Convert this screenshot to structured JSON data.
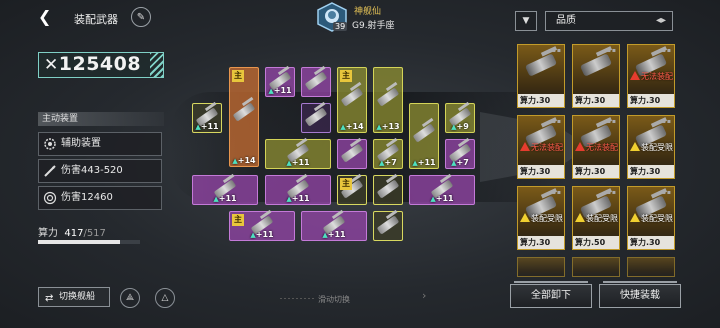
{
  "header": {
    "title": "装配武器",
    "commander_name": "神舰仙",
    "commander_sub": "G9.射手座",
    "commander_level": "39"
  },
  "left_panel": {
    "power_value": "125408",
    "active_label": "主动装置",
    "stats": [
      {
        "icon": "gear-icon",
        "text": "辅助装置"
      },
      {
        "icon": "missile-icon",
        "text": "伤害443-520"
      },
      {
        "icon": "target-icon",
        "text": "伤害12460"
      }
    ],
    "capacity_label": "算力",
    "capacity_current": "417",
    "capacity_max": "/517",
    "capacity_fraction": 0.8066
  },
  "bottom_left": {
    "switch_label": "切换舰船",
    "slide_hint": "滑动切换"
  },
  "slots": [
    {
      "color": "yellowdark",
      "lvl": "+11"
    },
    {
      "color": "orange",
      "lvl": "+14",
      "main": true
    },
    {
      "color": "purple",
      "lvl": "+11"
    },
    {
      "color": "purple",
      "lvl": ""
    },
    {
      "color": "dark",
      "lvl": ""
    },
    {
      "color": "yellow",
      "lvl": "+14",
      "main": true
    },
    {
      "color": "yellow",
      "lvl": "+13"
    },
    {
      "color": "yellow",
      "lvl": "+11"
    },
    {
      "color": "yellow",
      "lvl": "+9"
    },
    {
      "color": "yellow",
      "lvl": "+11"
    },
    {
      "color": "yellow",
      "lvl": "+7"
    },
    {
      "color": "purple",
      "lvl": "+7"
    },
    {
      "color": "purple",
      "lvl": "+11"
    },
    {
      "color": "purple",
      "lvl": "+11"
    },
    {
      "color": "yellowdark",
      "lvl": "",
      "main": true
    },
    {
      "color": "yellowdark",
      "lvl": ""
    },
    {
      "color": "purple",
      "lvl": "+11"
    },
    {
      "color": "purple",
      "lvl": "+11",
      "main": true
    },
    {
      "color": "purple",
      "lvl": "+11"
    },
    {
      "color": "yellowdark",
      "lvl": ""
    },
    {
      "color": "purple",
      "lvl": ""
    }
  ],
  "main_tag": "主",
  "right_panel": {
    "sort_label": "品质",
    "cards": [
      {
        "foot": "算力.30",
        "warn": ""
      },
      {
        "foot": "算力.30",
        "warn": ""
      },
      {
        "foot": "算力.30",
        "warn": "无法装配",
        "warn_type": "red"
      },
      {
        "foot": "算力.30",
        "warn": "无法装配",
        "warn_type": "red"
      },
      {
        "foot": "算力.30",
        "warn": "无法装配",
        "warn_type": "red"
      },
      {
        "foot": "算力.30",
        "warn": "装配受限",
        "warn_type": "yellow"
      },
      {
        "foot": "算力.30",
        "warn": "装配受限",
        "warn_type": "yellow"
      },
      {
        "foot": "算力.50",
        "warn": "装配受限",
        "warn_type": "yellow"
      },
      {
        "foot": "算力.30",
        "warn": "装配受限",
        "warn_type": "yellow"
      }
    ],
    "unequip_all": "全部卸下",
    "quick_equip": "快捷装载"
  }
}
